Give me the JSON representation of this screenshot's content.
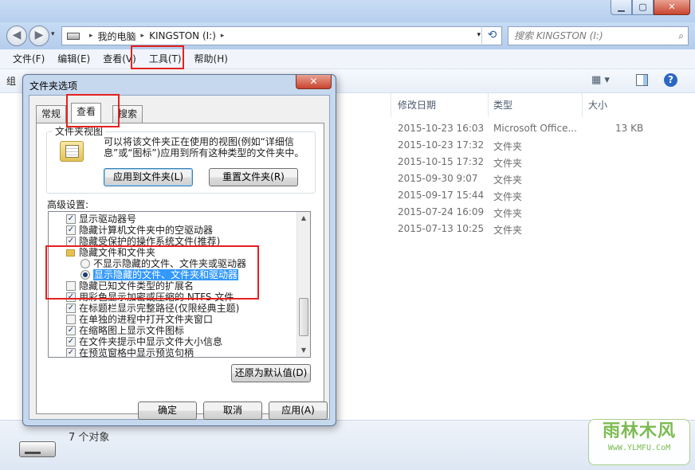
{
  "window": {
    "title_buttons": {
      "minimize": "▁",
      "maximize": "▢",
      "close": "✕"
    }
  },
  "nav": {
    "back_icon": "◀",
    "forward_icon": "▶",
    "breadcrumb": [
      "我的电脑",
      "KINGSTON (I:)"
    ],
    "separator": "▸",
    "dropdown_icon": "▾",
    "refresh_icon": "⟲",
    "search_placeholder": "搜索 KINGSTON (I:)",
    "search_icon": "⌕"
  },
  "menubar": {
    "items": [
      "文件(F)",
      "编辑(E)",
      "查看(V)",
      "工具(T)",
      "帮助(H)"
    ]
  },
  "toolbar": {
    "organize_label": "组",
    "view_icon": "▦ ▾",
    "help_icon": "?"
  },
  "file_list": {
    "columns": [
      "修改日期",
      "类型",
      "大小"
    ],
    "rows": [
      {
        "date": "2015-10-23 16:03",
        "type": "Microsoft Office...",
        "size": "13 KB"
      },
      {
        "date": "2015-10-23 17:32",
        "type": "文件夹",
        "size": ""
      },
      {
        "date": "2015-10-15 17:32",
        "type": "文件夹",
        "size": ""
      },
      {
        "date": "2015-09-30 9:07",
        "type": "文件夹",
        "size": ""
      },
      {
        "date": "2015-09-17 15:44",
        "type": "文件夹",
        "size": ""
      },
      {
        "date": "2015-07-24 16:09",
        "type": "文件夹",
        "size": ""
      },
      {
        "date": "2015-07-13 10:25",
        "type": "文件夹",
        "size": ""
      }
    ]
  },
  "status": {
    "count_text": "7 个对象"
  },
  "watermark": {
    "main": "雨林木风",
    "sub": "WwW.YLMFU.CoM"
  },
  "dialog": {
    "title": "文件夹选项",
    "close_icon": "✕",
    "tabs": [
      "常规",
      "查看",
      "搜索"
    ],
    "active_tab": "查看",
    "folder_views": {
      "label": "文件夹视图",
      "description": "可以将该文件夹正在使用的视图(例如“详细信息”或“图标”)应用到所有这种类型的文件夹中。",
      "apply_button": "应用到文件夹(L)",
      "reset_button": "重置文件夹(R)"
    },
    "advanced": {
      "label": "高级设置:",
      "items": [
        {
          "kind": "check",
          "checked": true,
          "label": "显示驱动器号"
        },
        {
          "kind": "check",
          "checked": true,
          "label": "隐藏计算机文件夹中的空驱动器"
        },
        {
          "kind": "check",
          "checked": true,
          "label": "隐藏受保护的操作系统文件(推荐)"
        },
        {
          "kind": "folder",
          "label": "隐藏文件和文件夹"
        },
        {
          "kind": "radio",
          "selected": false,
          "label": "不显示隐藏的文件、文件夹或驱动器"
        },
        {
          "kind": "radio",
          "selected": true,
          "label": "显示隐藏的文件、文件夹和驱动器"
        },
        {
          "kind": "check",
          "checked": false,
          "label": "隐藏已知文件类型的扩展名"
        },
        {
          "kind": "check",
          "checked": true,
          "label": "用彩色显示加密或压缩的 NTFS 文件"
        },
        {
          "kind": "check",
          "checked": true,
          "label": "在标题栏显示完整路径(仅限经典主题)"
        },
        {
          "kind": "check",
          "checked": false,
          "label": "在单独的进程中打开文件夹窗口"
        },
        {
          "kind": "check",
          "checked": true,
          "label": "在缩略图上显示文件图标"
        },
        {
          "kind": "check",
          "checked": true,
          "label": "在文件夹提示中显示文件大小信息"
        },
        {
          "kind": "check",
          "checked": true,
          "label": "在预览窗格中显示预览句柄"
        }
      ]
    },
    "restore_button": "还原为默认值(D)",
    "ok_button": "确定",
    "cancel_button": "取消",
    "apply_button": "应用(A)"
  },
  "colors": {
    "highlight_red": "#e5211f",
    "selection_blue": "#3399ff",
    "watermark_green": "#7cbb52"
  }
}
